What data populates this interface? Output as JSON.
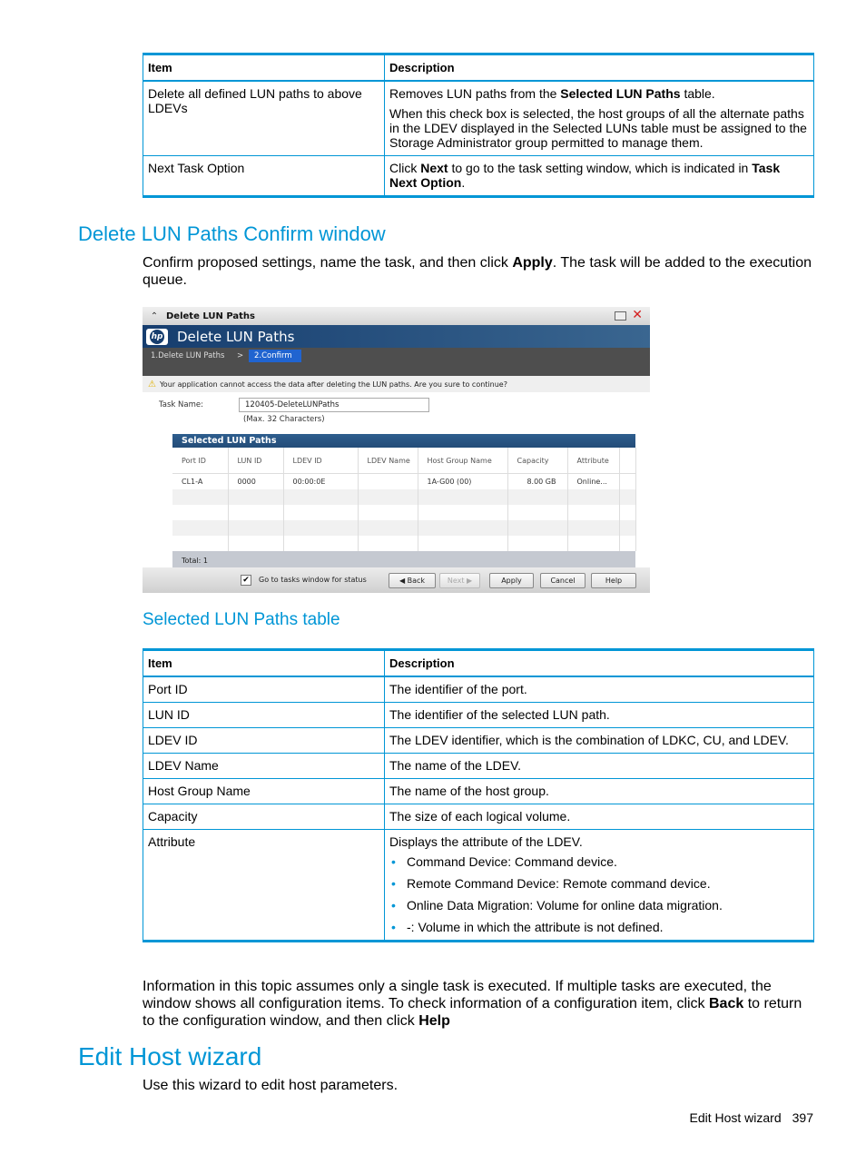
{
  "table1": {
    "headers": [
      "Item",
      "Description"
    ],
    "rows": [
      {
        "item": "Delete all defined LUN paths to above LDEVs",
        "desc1_pre": "Removes LUN paths from the ",
        "desc1_bold": "Selected LUN Paths",
        "desc1_post": " table.",
        "desc2": "When this check box is selected, the host groups of all the alternate paths in the LDEV displayed in the Selected LUNs table must be assigned to the Storage Administrator group permitted to manage them."
      },
      {
        "item": "Next Task Option",
        "desc_pre": "Click ",
        "desc_bold1": "Next",
        "desc_mid": " to go to the task setting window, which is indicated in ",
        "desc_bold2": "Task Next Option",
        "desc_post": "."
      }
    ]
  },
  "section1": {
    "heading": "Delete LUN Paths Confirm window",
    "intro_pre": "Confirm proposed settings, name the task, and then click ",
    "intro_bold": "Apply",
    "intro_post": ". The task will be added to the execution queue."
  },
  "dialog": {
    "window_title": "Delete LUN Paths",
    "banner_title": "Delete LUN Paths",
    "logo_text": "hp",
    "steps": [
      "1.Delete LUN Paths",
      ">",
      "2.Confirm"
    ],
    "warning": "Your application cannot access the data after deleting the LUN paths. Are you sure to continue?",
    "task_name_label": "Task Name:",
    "task_name_value": "120405-DeleteLUNPaths",
    "task_name_hint": "(Max. 32 Characters)",
    "table_title": "Selected LUN Paths",
    "columns": [
      "Port ID",
      "LUN ID",
      "LDEV ID",
      "LDEV Name",
      "Host Group Name",
      "Capacity",
      "Attribute"
    ],
    "rows": [
      [
        "CL1-A",
        "0000",
        "00:00:0E",
        "",
        "1A-G00 (00)",
        "8.00 GB",
        "Online..."
      ]
    ],
    "total": "Total:  1",
    "goto_tasks_label": "Go to tasks window for status",
    "goto_tasks_checked": true,
    "buttons": {
      "back": "◀ Back",
      "next": "Next ▶",
      "apply": "Apply",
      "cancel": "Cancel",
      "help": "Help"
    }
  },
  "section2": {
    "heading": "Selected LUN Paths table"
  },
  "table2": {
    "headers": [
      "Item",
      "Description"
    ],
    "rows": [
      {
        "item": "Port ID",
        "desc": "The identifier of the port."
      },
      {
        "item": "LUN ID",
        "desc": "The identifier of the selected LUN path."
      },
      {
        "item": "LDEV ID",
        "desc": "The LDEV identifier, which is the combination of LDKC, CU, and LDEV."
      },
      {
        "item": "LDEV Name",
        "desc": "The name of the LDEV."
      },
      {
        "item": "Host Group Name",
        "desc": "The name of the host group."
      },
      {
        "item": "Capacity",
        "desc": "The size of each logical volume."
      },
      {
        "item": "Attribute",
        "desc": "Displays the attribute of the LDEV.",
        "bullets": [
          "Command Device: Command device.",
          "Remote Command Device: Remote command device.",
          "Online Data Migration: Volume for online data migration.",
          "-: Volume in which the attribute is not defined."
        ]
      }
    ]
  },
  "note": {
    "text_pre": "Information in this topic assumes only a single task is executed. If multiple tasks are executed, the window shows all configuration items. To check information of a configuration item, click ",
    "bold1": "Back",
    "text_mid": " to return to the configuration window, and then click ",
    "bold2": "Help"
  },
  "section3": {
    "heading": "Edit Host wizard",
    "intro": "Use this wizard to edit host parameters."
  },
  "footer": {
    "section": "Edit Host wizard",
    "page": "397"
  },
  "colors": {
    "accent": "#0096d6",
    "dialog_banner": "#163d6e",
    "step_active": "#2064d0"
  }
}
